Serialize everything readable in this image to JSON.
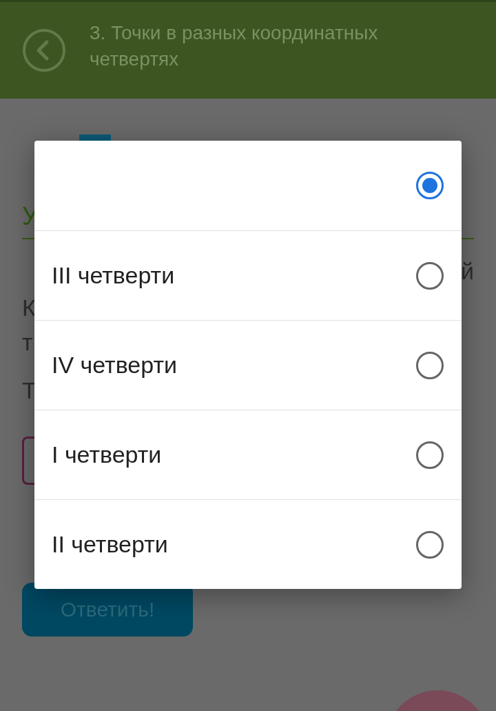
{
  "header": {
    "title": "3. Точки в разных координатных четвертях"
  },
  "background_fragments": [
    {
      "left": "У"
    },
    {
      "right": "й"
    },
    {
      "left": "К"
    },
    {
      "left": "т"
    },
    {
      "left": "Т"
    }
  ],
  "submit_button": {
    "label": "Ответить!"
  },
  "dialog": {
    "options": [
      {
        "selected": true
      },
      {
        "label": "III четверти",
        "selected": false
      },
      {
        "label": "IV четверти",
        "selected": false
      },
      {
        "label": "I четверти",
        "selected": false
      },
      {
        "label": "II четверти",
        "selected": false
      }
    ]
  }
}
